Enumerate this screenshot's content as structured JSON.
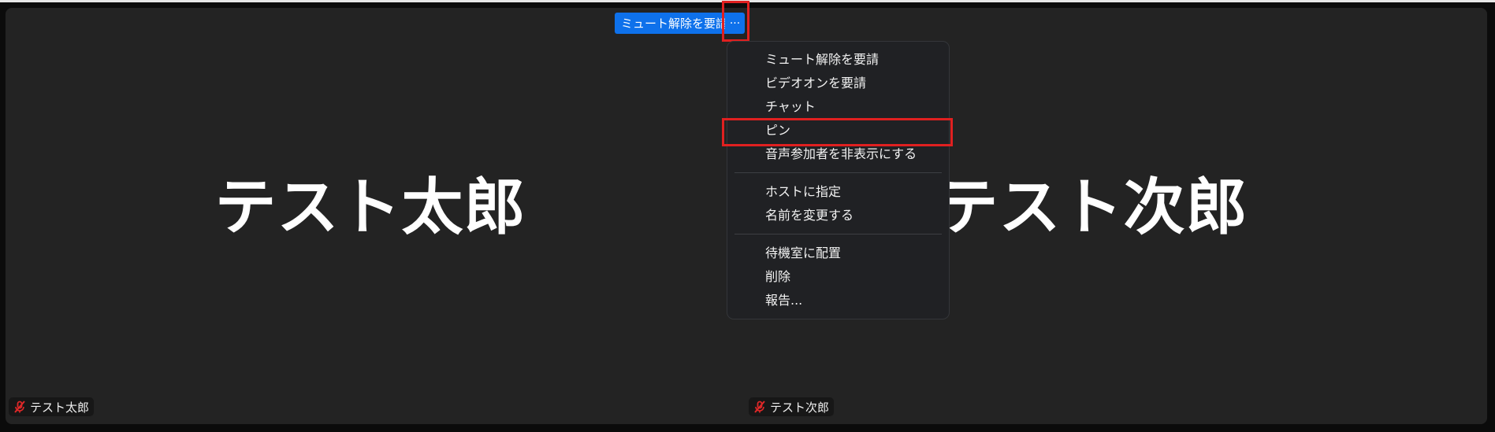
{
  "tiles": [
    {
      "name": "テスト太郎",
      "label": "テスト太郎"
    },
    {
      "name": "テスト次郎",
      "label": "テスト次郎"
    }
  ],
  "hover_controls": {
    "request_unmute_label": "ミュート解除を要請",
    "more_label": "···"
  },
  "menu": {
    "groups": [
      [
        "ミュート解除を要請",
        "ビデオオンを要請",
        "チャット",
        "ピン",
        "音声参加者を非表示にする"
      ],
      [
        "ホストに指定",
        "名前を変更する"
      ],
      [
        "待機室に配置",
        "削除",
        "報告..."
      ]
    ]
  },
  "icons": {
    "muted_mic": "muted-mic-icon",
    "more": "ellipsis-icon"
  },
  "colors": {
    "accent_blue": "#0e71eb",
    "highlight_red": "#e02020",
    "tile_bg": "#232323",
    "menu_bg": "#202124",
    "muted_icon": "#e02828"
  }
}
